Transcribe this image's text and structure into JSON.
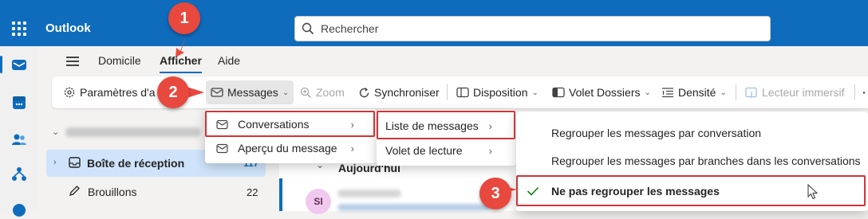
{
  "app": {
    "name": "Outlook"
  },
  "search": {
    "placeholder": "Rechercher"
  },
  "tabs": [
    {
      "label": "Domicile"
    },
    {
      "label": "Afficher"
    },
    {
      "label": "Aide"
    }
  ],
  "ribbon": {
    "settings": "Paramètres d'a",
    "messages": "Messages",
    "zoom": "Zoom",
    "sync": "Synchroniser",
    "layout": "Disposition",
    "folder_pane": "Volet Dossiers",
    "density": "Densité",
    "immersive_reader": "Lecteur immersif"
  },
  "folders": {
    "inbox": {
      "label": "Boîte de réception",
      "count": "117"
    },
    "drafts": {
      "label": "Brouillons",
      "count": "22"
    }
  },
  "message_list": {
    "group_today": "Aujourd'hui",
    "avatar_initials": "SI"
  },
  "menu_messages": {
    "items": [
      {
        "label": "Conversations"
      },
      {
        "label": "Aperçu du message"
      }
    ]
  },
  "menu_conversations": {
    "items": [
      {
        "label": "Liste de messages"
      },
      {
        "label": "Volet de lecture"
      }
    ]
  },
  "menu_grouping": {
    "items": [
      {
        "label": "Regrouper les messages par conversation"
      },
      {
        "label": "Regrouper les messages par branches dans les conversations"
      },
      {
        "label": "Ne pas regrouper les messages",
        "checked": true
      }
    ]
  },
  "callouts": [
    "1",
    "2",
    "3"
  ],
  "colors": {
    "brand": "#0f6cbd",
    "callout": "#e8483e",
    "highlight": "#d13438",
    "check": "#107c10"
  }
}
